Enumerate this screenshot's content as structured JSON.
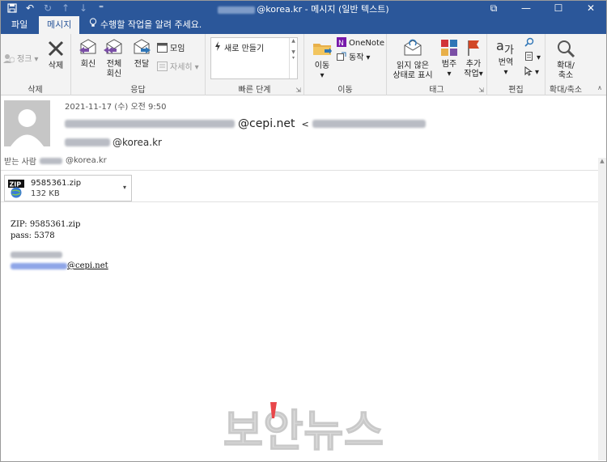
{
  "window": {
    "title": "@korea.kr - 메시지 (일반 텍스트)",
    "controls": {
      "restore": "⧉",
      "minimize": "—",
      "maximize": "☐",
      "close": "✕"
    }
  },
  "quick_access": [
    "save-icon",
    "undo-icon",
    "redo-icon",
    "up-icon",
    "down-icon",
    "more-icon"
  ],
  "tabs": [
    {
      "label": "파일"
    },
    {
      "label": "메시지"
    }
  ],
  "tellme": "수행할 작업을 알려 주세요.",
  "ribbon": {
    "delete_group": {
      "label": "삭제",
      "junk": "정크",
      "delete": "삭제"
    },
    "respond_group": {
      "label": "응답",
      "reply": "회신",
      "reply_all_1": "전체",
      "reply_all_2": "회신",
      "forward": "전달",
      "meeting": "모임",
      "more": "자세히"
    },
    "quicksteps_group": {
      "label": "빠른 단계",
      "new": "새로 만들기"
    },
    "move_group": {
      "label": "이동",
      "move": "이동",
      "onenote": "OneNote",
      "actions": "동작"
    },
    "tags_group": {
      "label": "태그",
      "mark_unread_1": "읽지 않은",
      "mark_unread_2": "상태로 표시",
      "categorize": "범주",
      "followup_1": "추가",
      "followup_2": "작업"
    },
    "edit_group": {
      "label": "편집",
      "translate": "번역"
    },
    "zoom_group": {
      "label": "확대/축소",
      "zoom_1": "확대/",
      "zoom_2": "축소"
    }
  },
  "message": {
    "date": "2021-11-17 (수) 오전 9:50",
    "sender_domain": "@cepi.net",
    "sender_bracket": "<",
    "to_domain": "@korea.kr",
    "cc_label": "받는 사람",
    "cc_domain": "@korea.kr"
  },
  "attachment": {
    "name": "9585361.zip",
    "size": "132 KB",
    "icon_text": "ZIP"
  },
  "body": {
    "line1": "ZIP: 9585361.zip",
    "line2": "pass: 5378",
    "sig_email_domain": "@cepi.net"
  },
  "watermark": "보안뉴스",
  "colors": {
    "title_bar": "#2b579a",
    "ribbon_bg": "#f3f3f3",
    "watermark": "#d9d9d9",
    "watermark_accent": "#e8474a"
  }
}
